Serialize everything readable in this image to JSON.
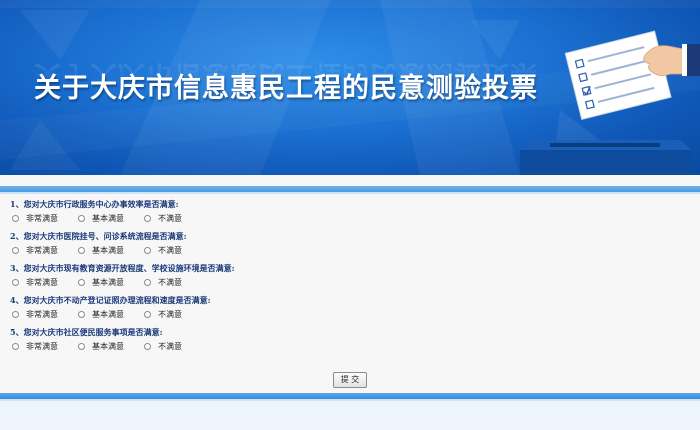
{
  "banner": {
    "title": "关于大庆市信息惠民工程的民意测验投票"
  },
  "questions": [
    {
      "label": "1、您对大庆市行政服务中心办事效率是否满意:",
      "options": [
        "非常满意",
        "基本满意",
        "不满意"
      ]
    },
    {
      "label": "2、您对大庆市医院挂号、问诊系统流程是否满意:",
      "options": [
        "非常满意",
        "基本满意",
        "不满意"
      ]
    },
    {
      "label": "3、您对大庆市现有教育资源开放程度、学校设施环境是否满意:",
      "options": [
        "非常满意",
        "基本满意",
        "不满意"
      ]
    },
    {
      "label": "4、您对大庆市不动产登记证照办理流程和速度是否满意:",
      "options": [
        "非常满意",
        "基本满意",
        "不满意"
      ]
    },
    {
      "label": "5、您对大庆市社区便民服务事项是否满意:",
      "options": [
        "非常满意",
        "基本满意",
        "不满意"
      ]
    }
  ],
  "submit_label": "提 交",
  "colors": {
    "banner_blue": "#1a6fd0",
    "question_text": "#1b3a7a",
    "bar_blue": "#4c9be0"
  }
}
